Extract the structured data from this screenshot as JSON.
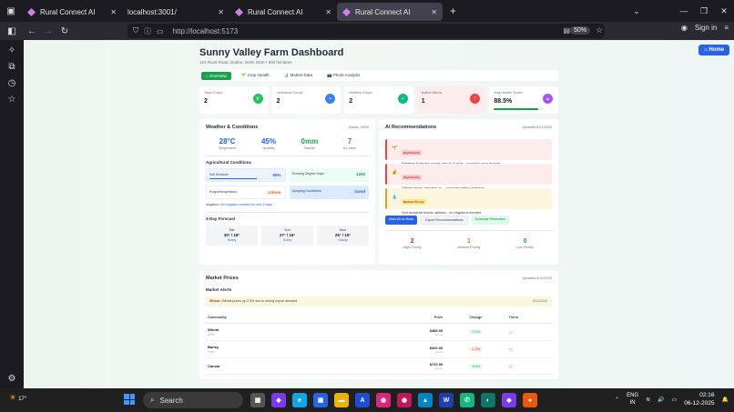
{
  "browser": {
    "tabs": [
      {
        "label": "Rural Connect AI",
        "active": false
      },
      {
        "label": "localhost:3001/",
        "active": false
      },
      {
        "label": "Rural Connect AI",
        "active": false
      },
      {
        "label": "Rural Connect AI",
        "active": true
      }
    ],
    "url": "http://localhost:5173",
    "zoom": "50%",
    "sign_in": "Sign in"
  },
  "page": {
    "home_button": "Home",
    "title": "Sunny Valley Farm Dashboard",
    "subtitle": "123 Rural Road, Dubbo, NSW 2830 • 500 hectares",
    "tabs": [
      "Overview",
      "Crop Health",
      "Market Data",
      "Photo Analysis"
    ],
    "stats": [
      {
        "label": "Total Crops",
        "value": "2",
        "icon": "leaf-icon",
        "color": "#22c55e"
      },
      {
        "label": "Livestock Count",
        "value": "2",
        "icon": "cow-icon",
        "color": "#3b82f6"
      },
      {
        "label": "Healthy Crops",
        "value": "2",
        "icon": "check-icon",
        "color": "#10b981"
      },
      {
        "label": "Active Alerts",
        "value": "1",
        "icon": "warning-icon",
        "color": "#ef4444"
      },
      {
        "label": "Avg Health Score",
        "value": "88.5%",
        "icon": "chart-icon",
        "color": "#a855f7",
        "progress": 0.885
      }
    ],
    "weather": {
      "title": "Weather & Conditions",
      "location": "Dubbo, NSW",
      "metrics": [
        {
          "value": "28°C",
          "label": "Temperature",
          "color": "#2563eb"
        },
        {
          "value": "45%",
          "label": "Humidity",
          "color": "#2563eb"
        },
        {
          "value": "0mm",
          "label": "Rainfall",
          "color": "#16a34a"
        },
        {
          "value": "7",
          "label": "UV Index",
          "color": "#ea580c"
        }
      ],
      "ag_title": "Agricultural Conditions",
      "conditions": {
        "soil_label": "Soil Moisture",
        "soil_value": "65%",
        "soil_progress": 0.65,
        "gdd_label": "Growing Degree Days",
        "gdd_value": "1250",
        "evap_label": "Evapotranspiration",
        "evap_value": "4.5mm",
        "spray_label": "Spraying Conditions",
        "spray_value": "Good"
      },
      "irrigation_label": "Irrigation:",
      "irrigation_value": "No irrigation needed for next 3 days",
      "forecast_title": "3-Day Forecast",
      "forecast": [
        {
          "day": "Sat",
          "temp": "30° / 18°",
          "cond": "Sunny"
        },
        {
          "day": "Sun",
          "temp": "27° / 16°",
          "cond": "Sunny"
        },
        {
          "day": "Mon",
          "temp": "25° / 15°",
          "cond": "Cloudy"
        }
      ]
    },
    "ai": {
      "title": "AI Recommendations",
      "updated": "Updated 6/12/2025",
      "recs": [
        {
          "priority": "High Priority",
          "text": "Weather forecast shows rain in 3 days - good for crop growth",
          "level": "high",
          "icon": "seedling-icon"
        },
        {
          "priority": "High Priority",
          "text": "Wheat prices trending up - consider selling strategy",
          "level": "high",
          "icon": "money-icon"
        },
        {
          "priority": "Medium Priority",
          "text": "Soil moisture levels optimal - no irrigation needed",
          "level": "medium",
          "icon": "droplet-icon"
        }
      ],
      "buttons": [
        "Mark All as Read",
        "Export Recommendations",
        "Schedule Reminders"
      ],
      "counts": [
        {
          "value": "2",
          "label": "High Priority",
          "color": "#dc2626"
        },
        {
          "value": "1",
          "label": "Medium Priority",
          "color": "#d97706"
        },
        {
          "value": "0",
          "label": "Low Priority",
          "color": "#16a34a"
        }
      ]
    },
    "market": {
      "title": "Market Prices",
      "updated": "Updated 6/12/2025",
      "alerts_title": "Market Alerts",
      "alert_name": "Wheat",
      "alert_text": "• Wheat prices up 2.5% due to strong export demand",
      "alert_time": "6/12/2025",
      "columns": [
        "Commodity",
        "Price",
        "Change",
        "Trend"
      ],
      "rows": [
        {
          "name": "Wheat",
          "sub": "APW",
          "price": "$385.00",
          "unit": "/tonne",
          "change": "+2.5%",
          "dir": "up",
          "trend": "📈"
        },
        {
          "name": "Barley",
          "sub": "Feed",
          "price": "$320.00",
          "unit": "/tonne",
          "change": "-1.2%",
          "dir": "down",
          "trend": "📉"
        },
        {
          "name": "Canola",
          "sub": "",
          "price": "$720.00",
          "unit": "/tonne",
          "change": "+5.8%",
          "dir": "up",
          "trend": "📈"
        }
      ]
    }
  },
  "taskbar": {
    "temp": "17°",
    "search": "Search",
    "lang1": "ENG",
    "lang2": "IN",
    "time": "02:16",
    "date": "06-12-2025"
  }
}
